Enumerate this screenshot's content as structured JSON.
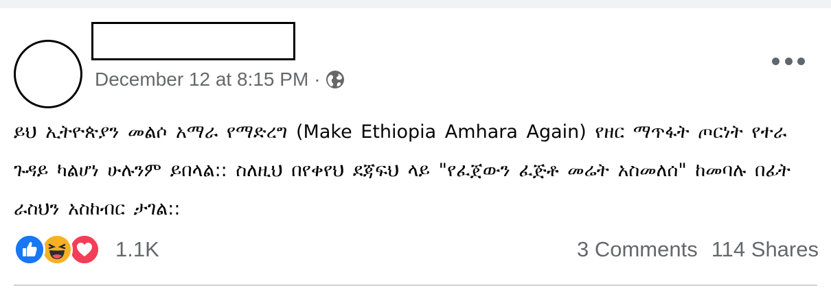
{
  "post": {
    "timestamp": "December 12 at 8:15 PM",
    "separator": "·",
    "privacy_icon": "globe-icon",
    "menu_icon": "more-horizontal-icon",
    "text": "ይህ ኢትዮጵያን መልሶ አማራ የማድረግ (Make Ethiopia Amhara Again) የዘር ማጥፋት ጦርነት የተራ ጉዳይ ካልሆነ ሁሉንም ይበላል:: ስለዚህ በየቀየህ ደጃፍህ ላይ \"የፈጀውን ፈጅቶ መሬት አስመለሰ\" ከመባሉ በፊት ራስህን አስከብር ታገል::"
  },
  "reactions": {
    "icons": [
      "like-icon",
      "haha-icon",
      "love-icon"
    ],
    "count": "1.1K"
  },
  "stats": {
    "comments": "3 Comments",
    "shares": "114 Shares"
  },
  "colors": {
    "like": "#1877f2",
    "haha": "#f7b125",
    "love": "#f33e58",
    "secondary_text": "#65676b",
    "background": "#f0f2f5"
  }
}
